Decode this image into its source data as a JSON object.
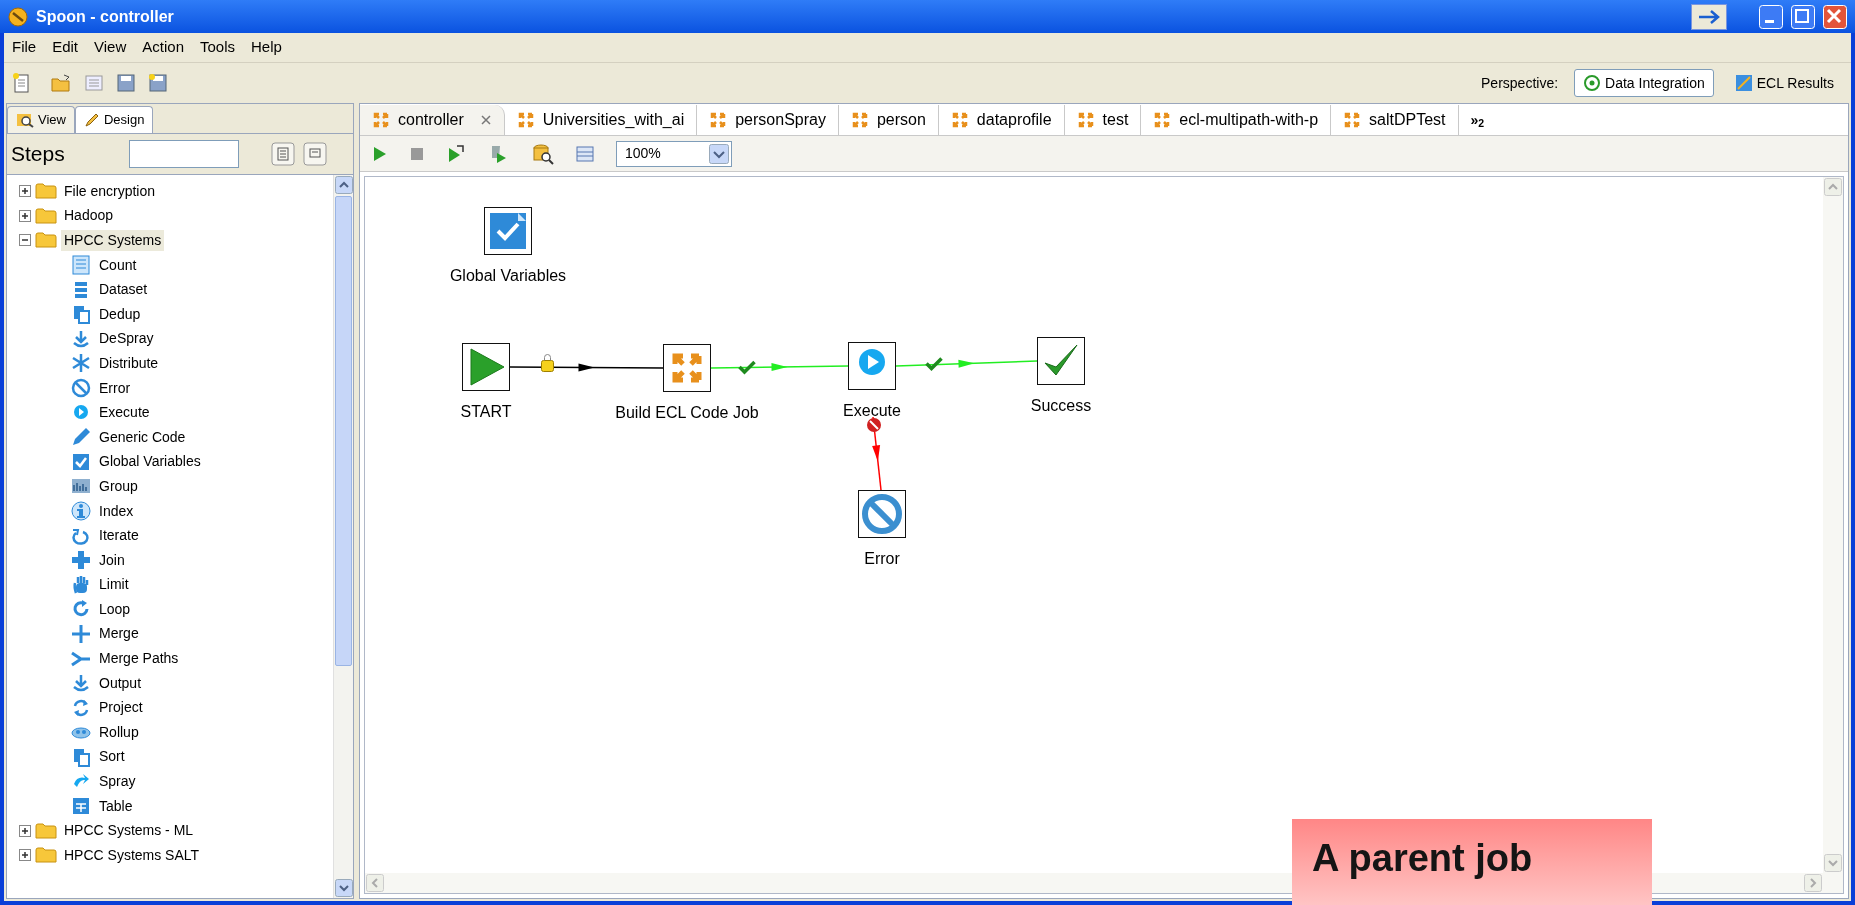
{
  "window": {
    "title": "Spoon - controller"
  },
  "menu": [
    "File",
    "Edit",
    "View",
    "Action",
    "Tools",
    "Help"
  ],
  "perspective": {
    "label": "Perspective:",
    "options": [
      {
        "label": "Data Integration",
        "selected": true
      },
      {
        "label": "ECL Results",
        "selected": false
      }
    ]
  },
  "left_tabs": [
    {
      "label": "View",
      "selected": false
    },
    {
      "label": "Design",
      "selected": true
    }
  ],
  "steps": {
    "title": "Steps"
  },
  "tree": [
    {
      "label": "File encryption",
      "expanded": false,
      "selected": false
    },
    {
      "label": "Hadoop",
      "expanded": false,
      "selected": false
    },
    {
      "label": "HPCC Systems",
      "expanded": true,
      "selected": true,
      "children": [
        {
          "label": "Count"
        },
        {
          "label": "Dataset"
        },
        {
          "label": "Dedup"
        },
        {
          "label": "DeSpray"
        },
        {
          "label": "Distribute"
        },
        {
          "label": "Error"
        },
        {
          "label": "Execute"
        },
        {
          "label": "Generic Code"
        },
        {
          "label": "Global Variables"
        },
        {
          "label": "Group"
        },
        {
          "label": "Index"
        },
        {
          "label": "Iterate"
        },
        {
          "label": "Join"
        },
        {
          "label": "Limit"
        },
        {
          "label": "Loop"
        },
        {
          "label": "Merge"
        },
        {
          "label": "Merge Paths"
        },
        {
          "label": "Output"
        },
        {
          "label": "Project"
        },
        {
          "label": "Rollup"
        },
        {
          "label": "Sort"
        },
        {
          "label": "Spray"
        },
        {
          "label": "Table"
        }
      ]
    },
    {
      "label": "HPCC Systems - ML",
      "expanded": false,
      "selected": false
    },
    {
      "label": "HPCC Systems SALT",
      "expanded": false,
      "selected": false
    }
  ],
  "editor_tabs": [
    {
      "label": "controller",
      "selected": true
    },
    {
      "label": "Universities_with_ai",
      "selected": false
    },
    {
      "label": "personSpray",
      "selected": false
    },
    {
      "label": "person",
      "selected": false
    },
    {
      "label": "dataprofile",
      "selected": false
    },
    {
      "label": "test",
      "selected": false
    },
    {
      "label": "ecl-multipath-with-p",
      "selected": false
    },
    {
      "label": "saltDPTest",
      "selected": false
    }
  ],
  "tab_overflow": "»$_{2}$",
  "zoom": {
    "value": "100%"
  },
  "canvas": {
    "nodes": [
      {
        "label": "Global Variables",
        "kind": "variables"
      },
      {
        "label": "START",
        "kind": "start"
      },
      {
        "label": "Build ECL Code Job",
        "kind": "build"
      },
      {
        "label": "Execute",
        "kind": "execute"
      },
      {
        "label": "Success",
        "kind": "success"
      },
      {
        "label": "Error",
        "kind": "error"
      }
    ],
    "hops": [
      {
        "kind": "unconditional"
      },
      {
        "kind": "success"
      },
      {
        "kind": "success"
      },
      {
        "kind": "failure"
      }
    ]
  },
  "callout": {
    "text": "A parent job"
  }
}
